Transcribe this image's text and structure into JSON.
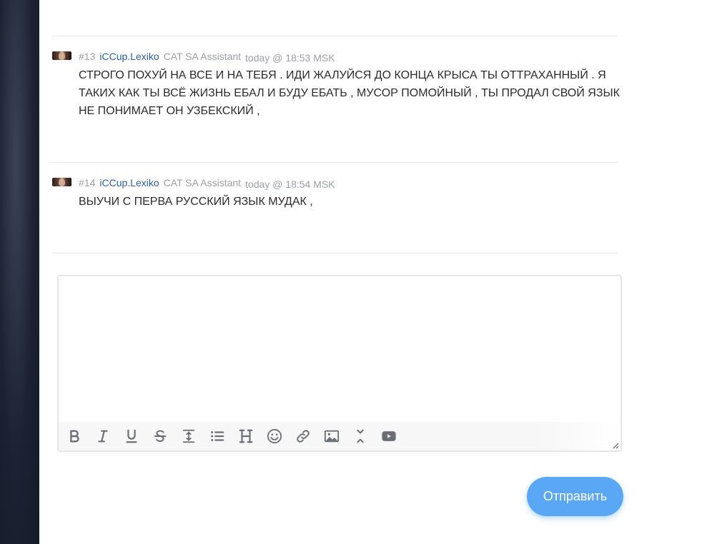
{
  "posts": [
    {
      "number": "#13",
      "username": "iCCup.Lexiko",
      "role": "CAT SA Assistant",
      "time": "today @ 18:53 MSK",
      "text": "СТРОГО ПОХУЙ НА ВСЕ И НА ТЕБЯ . ИДИ ЖАЛУЙСЯ ДО КОНЦА КРЫСА ТЫ ОТТРАХАННЫЙ . Я ТАКИХ КАК ТЫ ВСЁ ЖИЗНЬ ЕБАЛ И БУДУ ЕБАТЬ , МУСОР ПОМОЙНЫЙ , ТЫ ПРОДАЛ СВОЙ ЯЗЫК НЕ ПОНИМАЕТ ОН УЗБЕКСКИЙ ,"
    },
    {
      "number": "#14",
      "username": "iCCup.Lexiko",
      "role": "CAT SA Assistant",
      "time": "today @ 18:54 MSK",
      "text": "ВЫУЧИ С ПЕРВА РУССКИЙ ЯЗЫК МУДАК ,"
    }
  ],
  "editor": {
    "value": "",
    "toolbar_icons": [
      "bold-icon",
      "italic-icon",
      "underline-icon",
      "strikethrough-icon",
      "line-height-icon",
      "list-icon",
      "heading-icon",
      "emoji-icon",
      "link-icon",
      "image-icon",
      "collapse-icon",
      "youtube-icon"
    ]
  },
  "send_button": {
    "label": "Отправить"
  },
  "colors": {
    "accent": "#5aa8f5",
    "username": "#2a5fa5",
    "meta": "#9aa0a6"
  }
}
